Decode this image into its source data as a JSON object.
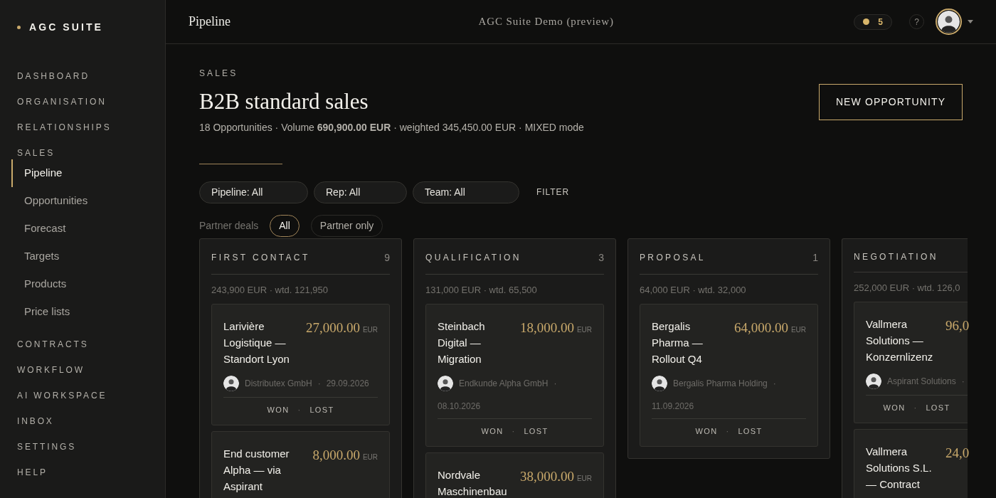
{
  "sidebar": {
    "brand": "AGC SUITE",
    "nav": [
      {
        "label": "DASHBOARD"
      },
      {
        "label": "ORGANISATION"
      },
      {
        "label": "RELATIONSHIPS"
      },
      {
        "label": "SALES",
        "children": [
          {
            "label": "Pipeline",
            "selected": true
          },
          {
            "label": "Opportunities",
            "selected": false
          },
          {
            "label": "Forecast",
            "selected": false
          },
          {
            "label": "Targets",
            "selected": false
          },
          {
            "label": "Products",
            "selected": false
          },
          {
            "label": "Price lists",
            "selected": false
          }
        ]
      },
      {
        "label": "CONTRACTS"
      },
      {
        "label": "WORKFLOW"
      },
      {
        "label": "AI WORKSPACE"
      },
      {
        "label": "INBOX"
      },
      {
        "label": "SETTINGS"
      },
      {
        "label": "HELP"
      }
    ]
  },
  "header": {
    "title": "Pipeline",
    "workspace": "AGC Suite Demo (preview)",
    "credits": "5",
    "help": "?"
  },
  "page": {
    "eyebrow": "SALES",
    "title": "B2B standard sales",
    "summary": "18 Opportunities · Volume **690,900.00 EUR** · weighted 345,450.00 EUR · MIXED mode",
    "action": "NEW OPPORTUNITY"
  },
  "filters": {
    "selects": [
      "Pipeline: All",
      "Rep: All",
      "Team: All"
    ],
    "button": "FILTER"
  },
  "partner": {
    "label": "Partner deals",
    "options": [
      {
        "label": "All",
        "selected": true
      },
      {
        "label": "Partner only",
        "selected": false
      }
    ]
  },
  "columns": [
    {
      "title": "FIRST CONTACT",
      "count": "9",
      "summary": "243,900 EUR · wtd. 121,950",
      "deals": [
        {
          "title": "Larivière Logistique — Standort Lyon",
          "amount": "27,000.00",
          "currency": "EUR",
          "client": "Distributex GmbH",
          "separator": "·",
          "date": "29.09.2026",
          "actions": [
            "WON",
            "LOST"
          ],
          "action_separator": "·"
        },
        {
          "title": "End customer Alpha — via Aspirant",
          "amount": "8,000.00",
          "currency": "EUR"
        }
      ]
    },
    {
      "title": "QUALIFICATION",
      "count": "3",
      "summary": "131,000 EUR · wtd. 65,500",
      "deals": [
        {
          "title": "Steinbach Digital — Migration",
          "amount": "18,000.00",
          "currency": "EUR",
          "client": "Endkunde Alpha GmbH",
          "separator": "·",
          "date": "08.10.2026",
          "actions": [
            "WON",
            "LOST"
          ],
          "action_separator": "·"
        },
        {
          "title": "Nordvale Maschinenbau",
          "amount": "38,000.00",
          "currency": "EUR"
        }
      ]
    },
    {
      "title": "PROPOSAL",
      "count": "1",
      "summary": "64,000 EUR · wtd. 32,000",
      "deals": [
        {
          "title": "Bergalis Pharma — Rollout Q4",
          "amount": "64,000.00",
          "currency": "EUR",
          "client": "Bergalis Pharma Holding",
          "separator": "·",
          "date": "11.09.2026",
          "actions": [
            "WON",
            "LOST"
          ],
          "action_separator": "·"
        }
      ]
    },
    {
      "title": "NEGOTIATION",
      "summary": "252,000 EUR · wtd. 126,0",
      "deals": [
        {
          "title": "Vallmera Solutions — Konzernlizenz",
          "amount": "96,0",
          "client": "Aspirant Solutions",
          "separator": "·",
          "actions": [
            "WON",
            "LOST"
          ],
          "action_separator": "·"
        },
        {
          "title": "Vallmera Solutions S.L. — Contract",
          "amount": "24,0"
        }
      ]
    }
  ]
}
